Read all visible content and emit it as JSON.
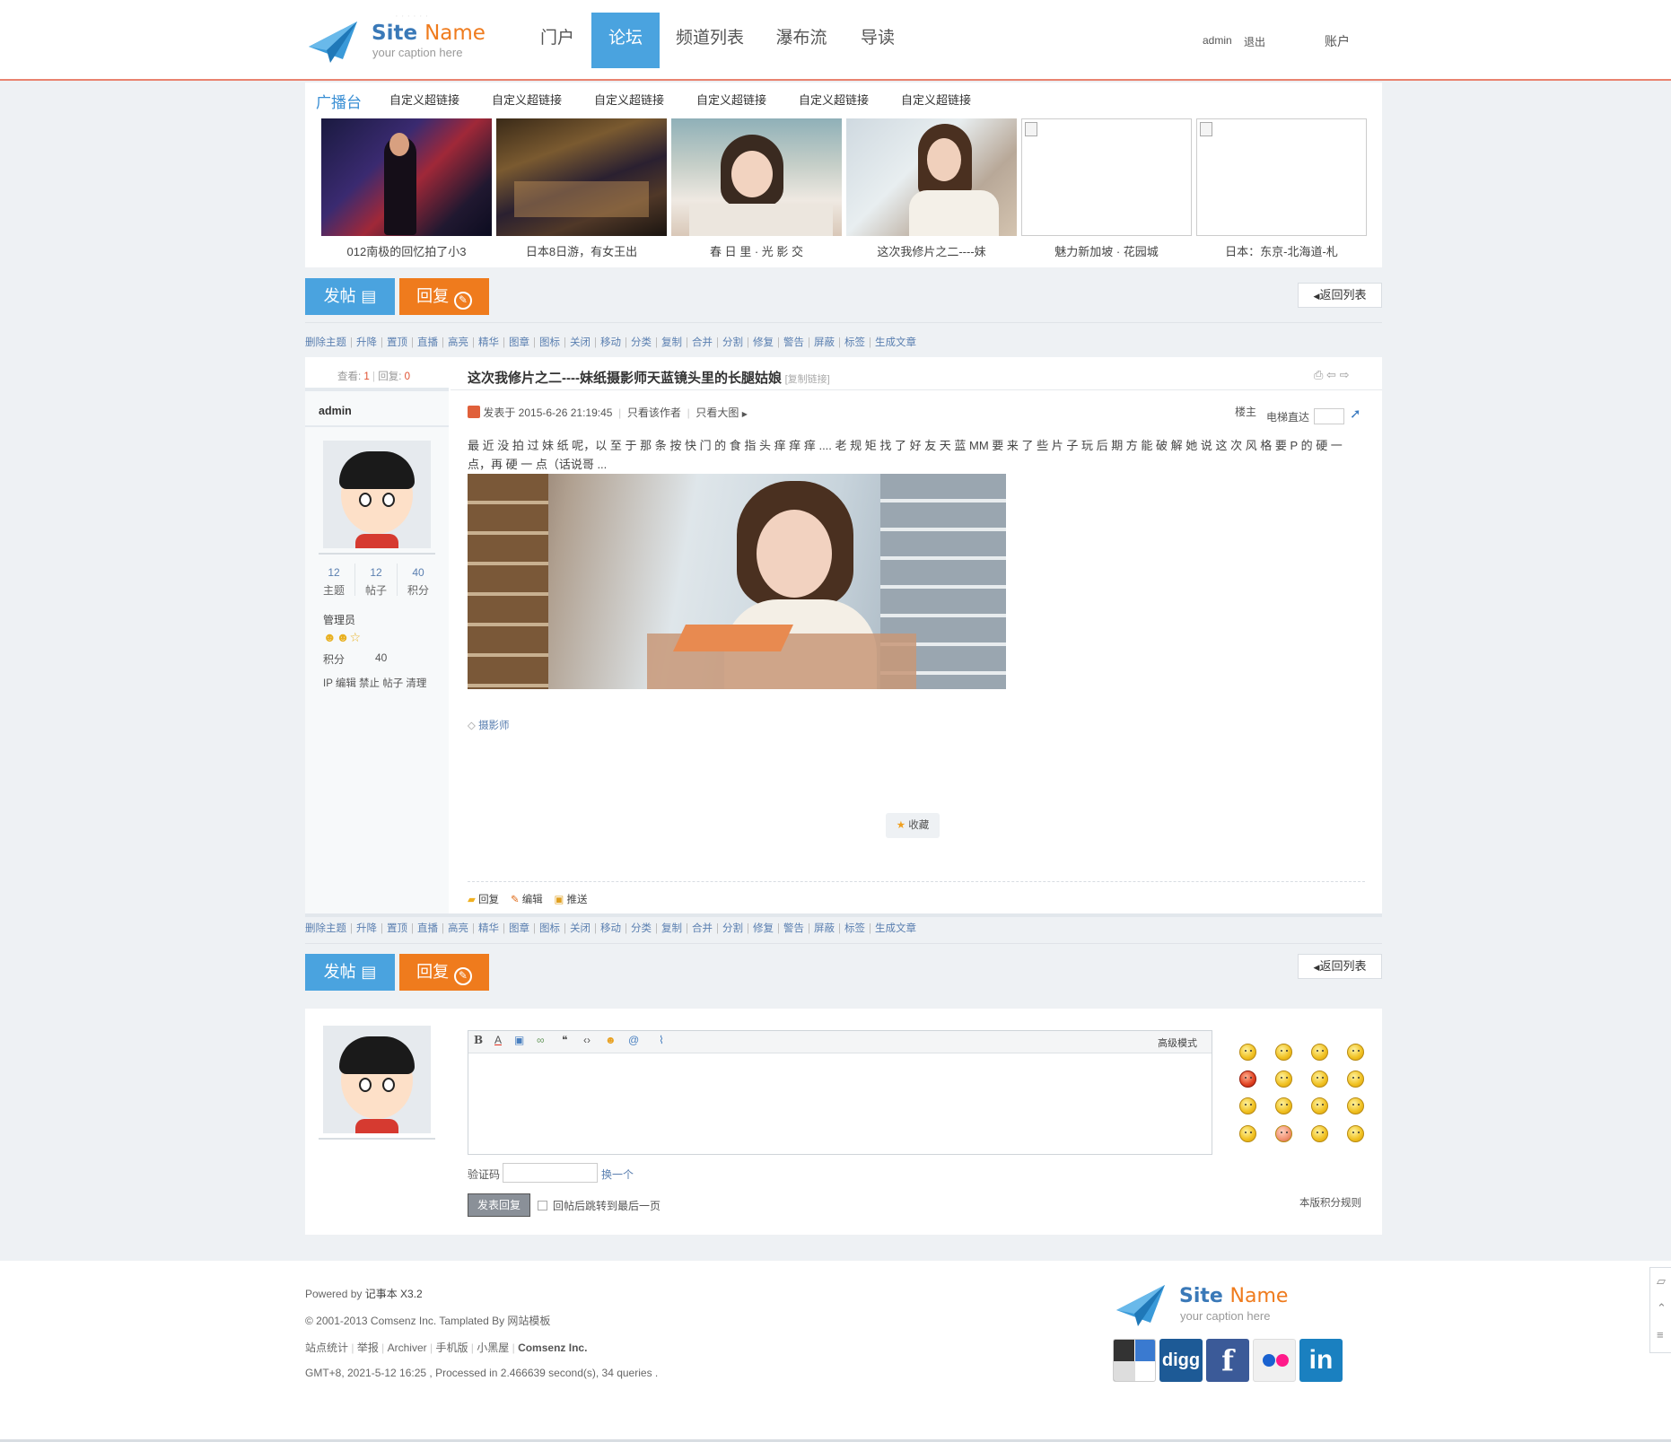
{
  "header": {
    "site_name_1": "Site",
    "site_name_2": "Name",
    "caption": "your caption here",
    "nav": [
      "门户",
      "论坛",
      "频道列表",
      "瀑布流",
      "导读"
    ],
    "user": "admin",
    "logout": "退出",
    "account": "账户",
    "accent_color": "#4aa3df",
    "brand_orange": "#ef7b1d"
  },
  "broadcast": {
    "title": "广播台",
    "links": [
      "自定义超链接",
      "自定义超链接",
      "自定义超链接",
      "自定义超链接",
      "自定义超链接",
      "自定义超链接"
    ],
    "items": [
      {
        "caption": "012南极的回忆拍了小3"
      },
      {
        "caption": "日本8日游，有女王出"
      },
      {
        "caption": "春 日 里 · 光 影 交"
      },
      {
        "caption": "这次我修片之二----妹"
      },
      {
        "caption": "魅力新加坡 · 花园城"
      },
      {
        "caption": "日本：东京-北海道-札"
      }
    ]
  },
  "actions": {
    "post": "发帖",
    "reply": "回复",
    "back": "返回列表"
  },
  "modbar": [
    "删除主题",
    "升降",
    "置顶",
    "直播",
    "高亮",
    "精华",
    "图章",
    "图标",
    "关闭",
    "移动",
    "分类",
    "复制",
    "合并",
    "分割",
    "修复",
    "警告",
    "屏蔽",
    "标签",
    "生成文章"
  ],
  "thread": {
    "views_label": "查看:",
    "views": "1",
    "replies_label": "回复:",
    "replies": "0",
    "title": "这次我修片之二----妹纸摄影师天蓝镜头里的长腿姑娘",
    "copy_link": "[复制链接]"
  },
  "author": {
    "name": "admin",
    "stats": [
      {
        "value": "12",
        "label": "主题"
      },
      {
        "value": "12",
        "label": "帖子"
      },
      {
        "value": "40",
        "label": "积分"
      }
    ],
    "group": "管理员",
    "credit_label": "积分",
    "credit_value": "40",
    "admin_links": "IP 编辑 禁止 帖子 清理"
  },
  "post": {
    "posted_at": "发表于 2015-6-26 21:19:45",
    "only_author": "只看该作者",
    "only_big": "只看大图",
    "floor": "楼主",
    "jump_label": "电梯直达",
    "body": "最 近 没 拍 过 妹 纸 呢，以 至 于 那 条 按 快 门 的 食 指 头 痒 痒 痒 .... 老 规 矩 找 了 好 友 天 蓝 MM 要 来 了 些 片 子 玩 后 期 方 能 破 解 她 说 这 次 风 格 要 P 的 硬 一 点，再 硬 一 点（话说哥 ...",
    "tag": "摄影师",
    "favorite": "收藏",
    "reply": "回复",
    "edit": "编辑",
    "push": "推送"
  },
  "editor": {
    "advanced": "高级模式",
    "captcha_label": "验证码",
    "captcha_change": "换一个",
    "submit": "发表回复",
    "jump_last": "回帖后跳转到最后一页",
    "rules": "本版积分规则"
  },
  "footer": {
    "powered_prefix": "Powered by ",
    "powered_name": "记事本 X3.2",
    "copyright": "© 2001-2013 Comsenz Inc. Tamplated By 网站模板",
    "links": [
      "站点统计",
      "举报",
      "Archiver",
      "手机版",
      "小黑屋"
    ],
    "company": "Comsenz Inc.",
    "meta": "GMT+8, 2021-5-12 16:25 , Processed in 2.466639 second(s), 34 queries .",
    "social": [
      "delicious",
      "digg",
      "f",
      "flickr",
      "in"
    ]
  }
}
